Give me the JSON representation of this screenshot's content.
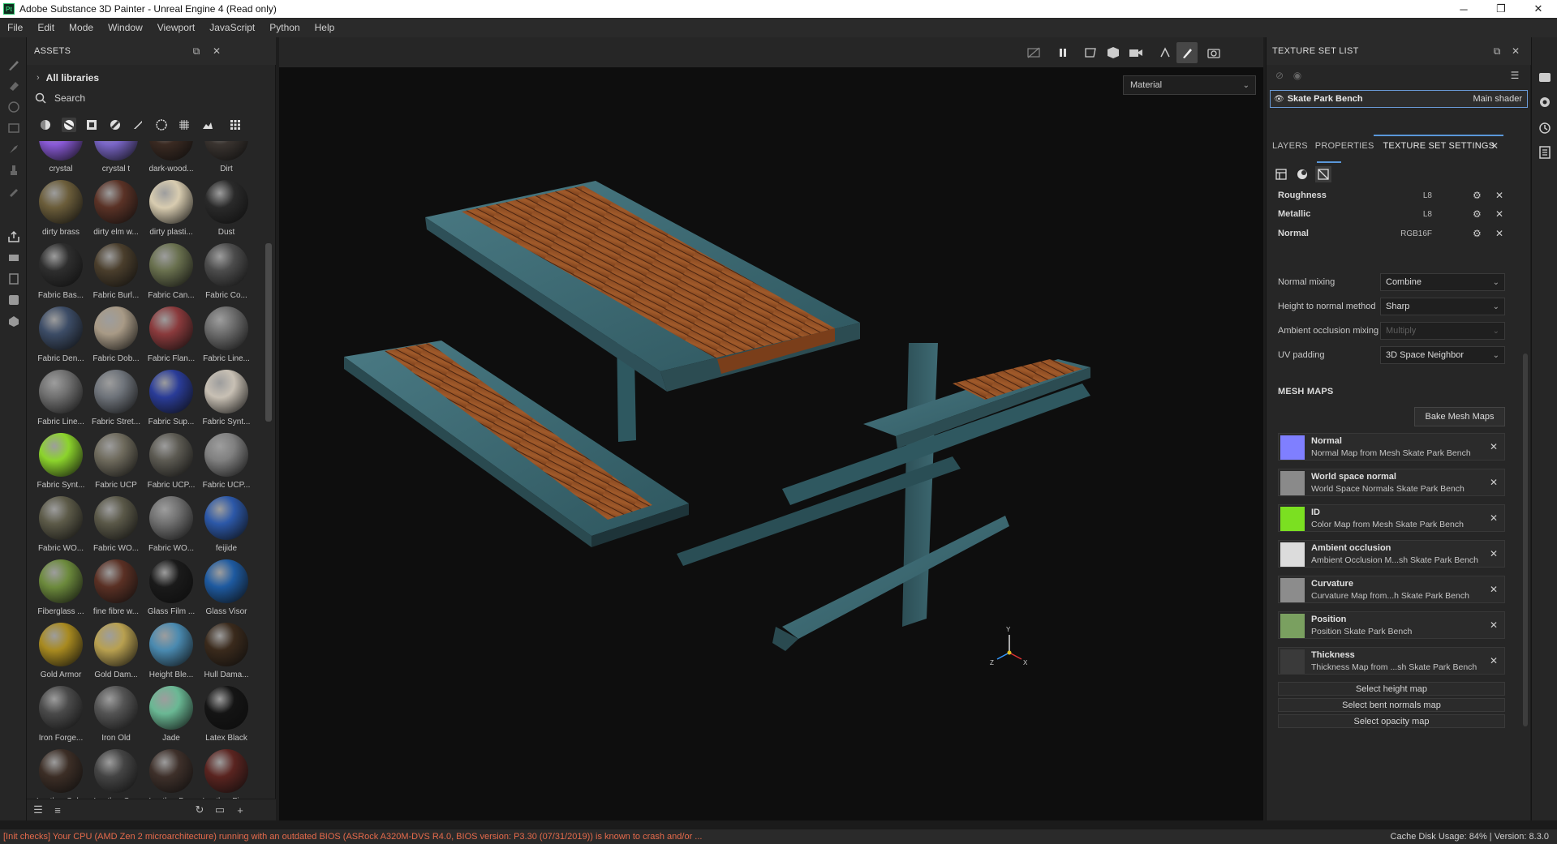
{
  "window": {
    "title": "Adobe Substance 3D Painter - Unreal Engine 4 (Read only)",
    "app_icon": "Pt",
    "minimize": "─",
    "maximize": "❐",
    "close": "✕"
  },
  "menu": [
    "File",
    "Edit",
    "Mode",
    "Window",
    "Viewport",
    "JavaScript",
    "Python",
    "Help"
  ],
  "assets": {
    "title": "ASSETS",
    "libraries": "All libraries",
    "search_placeholder": "Search",
    "items": [
      {
        "label": "crystal",
        "color": "#8a5ad8"
      },
      {
        "label": "crystal t",
        "color": "#7a66c8"
      },
      {
        "label": "dark-wood...",
        "color": "#3a2a22"
      },
      {
        "label": "Dirt",
        "color": "#3a3430"
      },
      {
        "label": "dirty brass",
        "color": "#6b5d3a"
      },
      {
        "label": "dirty elm w...",
        "color": "#5a3226"
      },
      {
        "label": "dirty plasti...",
        "color": "#d8ccb0"
      },
      {
        "label": "Dust",
        "color": "#2a2a2a"
      },
      {
        "label": "Fabric Bas...",
        "color": "#2e2e2e"
      },
      {
        "label": "Fabric Burl...",
        "color": "#4a3e2c"
      },
      {
        "label": "Fabric Can...",
        "color": "#69704e"
      },
      {
        "label": "Fabric Co...",
        "color": "#4c4c4c"
      },
      {
        "label": "Fabric Den...",
        "color": "#3c4c66"
      },
      {
        "label": "Fabric Dob...",
        "color": "#a89a86"
      },
      {
        "label": "Fabric Flan...",
        "color": "#8a3a3c"
      },
      {
        "label": "Fabric Line...",
        "color": "#6c6c6c"
      },
      {
        "label": "Fabric Line...",
        "color": "#707070"
      },
      {
        "label": "Fabric Stret...",
        "color": "#6e737a"
      },
      {
        "label": "Fabric Sup...",
        "color": "#2a3c98"
      },
      {
        "label": "Fabric Synt...",
        "color": "#c8c0b4"
      },
      {
        "label": "Fabric Synt...",
        "color": "#8cd42c"
      },
      {
        "label": "Fabric UCP",
        "color": "#6e6a5c"
      },
      {
        "label": "Fabric UCP...",
        "color": "#5c5a52"
      },
      {
        "label": "Fabric UCP...",
        "color": "#808080"
      },
      {
        "label": "Fabric WO...",
        "color": "#5c5a48"
      },
      {
        "label": "Fabric WO...",
        "color": "#5a5848"
      },
      {
        "label": "Fabric WO...",
        "color": "#707070"
      },
      {
        "label": "feijide",
        "color": "#2c58a8"
      },
      {
        "label": "Fiberglass ...",
        "color": "#6c8a3c"
      },
      {
        "label": "fine fibre w...",
        "color": "#5a3024"
      },
      {
        "label": "Glass Film ...",
        "color": "#1a1a1a"
      },
      {
        "label": "Glass Visor",
        "color": "#1e5aa0"
      },
      {
        "label": "Gold Armor",
        "color": "#a88a20"
      },
      {
        "label": "Gold Dam...",
        "color": "#b8a050"
      },
      {
        "label": "Height Ble...",
        "color": "#4a8ab0"
      },
      {
        "label": "Hull Dama...",
        "color": "#3a2a1c"
      },
      {
        "label": "Iron Forge...",
        "color": "#4a4a4a"
      },
      {
        "label": "Iron Old",
        "color": "#545454"
      },
      {
        "label": "Jade",
        "color": "#6ab894"
      },
      {
        "label": "Latex Black",
        "color": "#141414"
      },
      {
        "label": "Leather Cal...",
        "color": "#3c2e26"
      },
      {
        "label": "Leather Cr...",
        "color": "#444444"
      },
      {
        "label": "Leather Dr...",
        "color": "#3e302a"
      },
      {
        "label": "Leather Fin...",
        "color": "#5a2420"
      }
    ]
  },
  "viewport": {
    "material_mode": "Material"
  },
  "texture_set_list": {
    "title": "TEXTURE SET LIST",
    "set_name": "Skate Park Bench",
    "shader": "Main shader"
  },
  "tabs": {
    "layers": "LAYERS",
    "properties": "PROPERTIES",
    "texture_set_settings": "TEXTURE SET SETTINGS"
  },
  "channels": [
    {
      "name": "Roughness",
      "format": "L8"
    },
    {
      "name": "Metallic",
      "format": "L8"
    },
    {
      "name": "Normal",
      "format": "RGB16F"
    }
  ],
  "settings": [
    {
      "label": "Normal mixing",
      "value": "Combine",
      "enabled": true
    },
    {
      "label": "Height to normal method",
      "value": "Sharp",
      "enabled": true
    },
    {
      "label": "Ambient occlusion mixing",
      "value": "Multiply",
      "enabled": false
    },
    {
      "label": "UV padding",
      "value": "3D Space Neighbor",
      "enabled": true
    }
  ],
  "mesh_maps": {
    "title": "MESH MAPS",
    "bake_button": "Bake Mesh Maps",
    "maps": [
      {
        "title": "Normal",
        "subtitle": "Normal Map from Mesh Skate Park Bench",
        "thumb_color": "#7f7fff"
      },
      {
        "title": "World space normal",
        "subtitle": "World Space Normals Skate Park Bench",
        "thumb_color": "#8a8a8a"
      },
      {
        "title": "ID",
        "subtitle": "Color Map from Mesh Skate Park Bench",
        "thumb_color": "#7be021"
      },
      {
        "title": "Ambient occlusion",
        "subtitle": "Ambient Occlusion M...sh Skate Park Bench",
        "thumb_color": "#dcdcdc"
      },
      {
        "title": "Curvature",
        "subtitle": "Curvature Map from...h Skate Park Bench",
        "thumb_color": "#8c8c8c"
      },
      {
        "title": "Position",
        "subtitle": "Position Skate Park Bench",
        "thumb_color": "#7aa060"
      },
      {
        "title": "Thickness",
        "subtitle": "Thickness Map from ...sh Skate Park Bench",
        "thumb_color": "#3a3a3a"
      }
    ],
    "select_buttons": [
      "Select height map",
      "Select bent normals map",
      "Select opacity map"
    ]
  },
  "status": {
    "error": "[Init checks] Your CPU (AMD Zen 2 microarchitecture) running with an outdated BIOS (ASRock A320M-DVS R4.0, BIOS version: P3.30 (07/31/2019)) is known to crash and/or ...",
    "cache": "Cache Disk Usage:   84% | Version: 8.3.0"
  }
}
